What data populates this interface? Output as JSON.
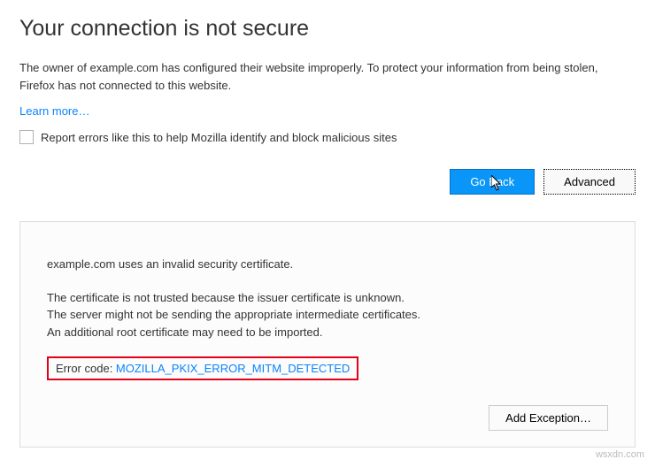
{
  "title": "Your connection is not secure",
  "description": "The owner of example.com has configured their website improperly. To protect your information from being stolen, Firefox has not connected to this website.",
  "learn_more": "Learn more…",
  "report_checkbox_label": "Report errors like this to help Mozilla identify and block malicious sites",
  "buttons": {
    "go_back": "Go Back",
    "advanced": "Advanced"
  },
  "details": {
    "line1": "example.com uses an invalid security certificate.",
    "line2": "The certificate is not trusted because the issuer certificate is unknown.",
    "line3": "The server might not be sending the appropriate intermediate certificates.",
    "line4": "An additional root certificate may need to be imported.",
    "error_label": "Error code: ",
    "error_code": "MOZILLA_PKIX_ERROR_MITM_DETECTED"
  },
  "add_exception": "Add Exception…",
  "watermark": "wsxdn.com"
}
